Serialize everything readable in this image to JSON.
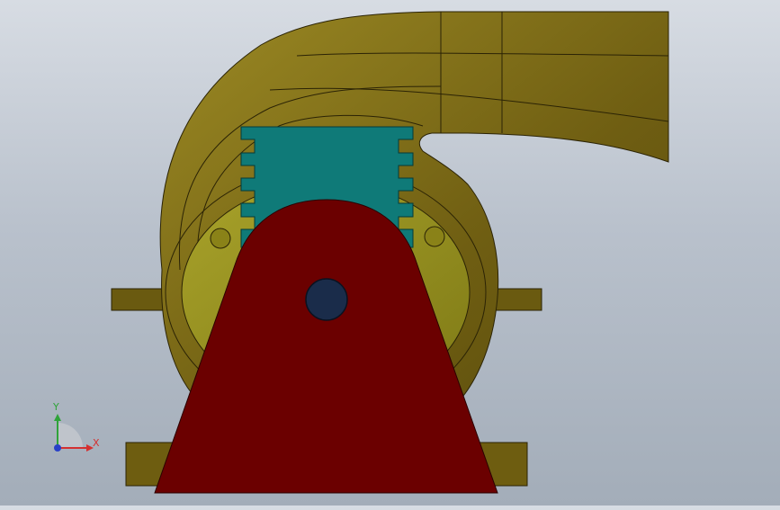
{
  "viewport": {
    "triad": {
      "x_label": "X",
      "y_label": "Y",
      "x_color": "#d43030",
      "y_color": "#2fa33a",
      "z_color": "#2840c8"
    },
    "parts": [
      {
        "name": "volute-casing",
        "color": "#7a6a18"
      },
      {
        "name": "side-plate",
        "color": "#9a9620"
      },
      {
        "name": "impeller",
        "color": "#0f7a78"
      },
      {
        "name": "pedestal-support",
        "color": "#6b0000"
      },
      {
        "name": "shaft",
        "color": "#1a2c4a"
      },
      {
        "name": "base-plate",
        "color": "#6a5a10"
      }
    ]
  }
}
